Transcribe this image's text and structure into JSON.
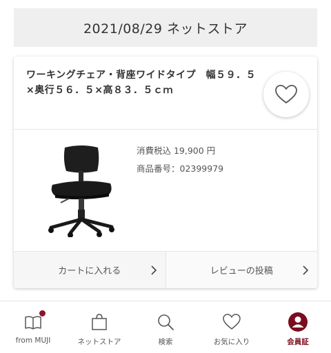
{
  "header": {
    "date_store": "2021/08/29 ネットストア"
  },
  "product": {
    "name": "ワーキングチェア・背座ワイドタイプ　幅５９．５×奥行５６．５×高８３．５ｃｍ",
    "price": "消費税込 19,900 円",
    "sku": "商品番号：02399979",
    "image_icon": "office-chair-image",
    "favorite_icon": "heart-icon"
  },
  "actions": {
    "add_to_cart": "カートに入れる",
    "post_review": "レビューの投稿"
  },
  "tabbar": {
    "items": [
      {
        "label": "from MUJI",
        "icon": "book-icon",
        "badge": true
      },
      {
        "label": "ネットストア",
        "icon": "shopping-bag-icon"
      },
      {
        "label": "検索",
        "icon": "search-icon"
      },
      {
        "label": "お気に入り",
        "icon": "heart-icon"
      },
      {
        "label": "会員証",
        "icon": "member-card-icon",
        "active": true
      }
    ]
  },
  "colors": {
    "accent": "#7a0e1e",
    "badge": "#8b1426",
    "header_bg": "#efefef"
  }
}
